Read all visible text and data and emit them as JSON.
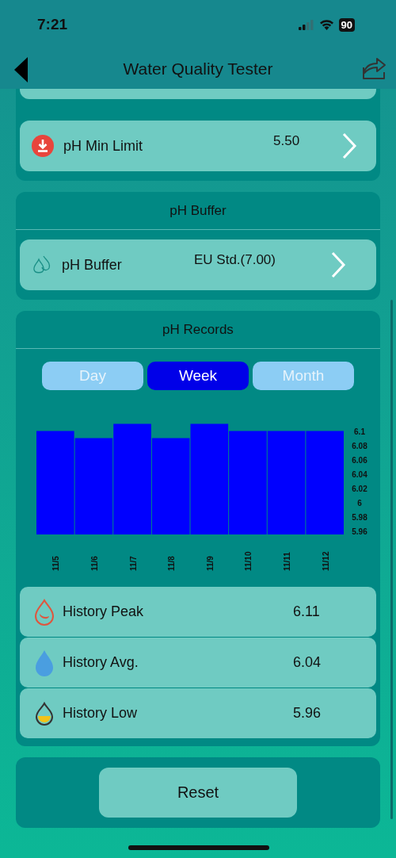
{
  "status_bar": {
    "time": "7:21",
    "battery": "90"
  },
  "nav": {
    "title": "Water Quality Tester"
  },
  "limit_row": {
    "label": "pH Min Limit",
    "value": "5.50"
  },
  "buffer": {
    "title": "pH Buffer",
    "row": {
      "label": "pH Buffer",
      "value": "EU Std.(7.00)"
    }
  },
  "records": {
    "title": "pH Records",
    "periods": [
      {
        "label": "Day",
        "selected": false
      },
      {
        "label": "Week",
        "selected": true
      },
      {
        "label": "Month",
        "selected": false
      }
    ],
    "chart_data": {
      "type": "bar",
      "categories": [
        "11/5",
        "11/6",
        "11/7",
        "11/8",
        "11/9",
        "11/10",
        "11/11",
        "11/12"
      ],
      "series": [
        {
          "color": "#0000ff",
          "values": [
            6.1,
            6.09,
            6.11,
            6.09,
            6.11,
            6.1,
            6.1,
            6.1
          ]
        }
      ],
      "ylim": [
        5.955,
        6.115
      ],
      "yticks": [
        {
          "value": 5.96,
          "label": "5.96"
        },
        {
          "value": 5.98,
          "label": "5.98"
        },
        {
          "value": 6,
          "label": "6"
        },
        {
          "value": 6.02,
          "label": "6.02"
        },
        {
          "value": 6.04,
          "label": "6.04"
        },
        {
          "value": 6.06,
          "label": "6.06"
        },
        {
          "value": 6.08,
          "label": "6.08"
        },
        {
          "value": 6.1,
          "label": "6.1"
        }
      ]
    },
    "stats": [
      {
        "kind": "peak",
        "label": "History Peak",
        "value": "6.11"
      },
      {
        "kind": "avg",
        "label": "History Avg.",
        "value": "6.04"
      },
      {
        "kind": "low",
        "label": "History Low",
        "value": "5.96"
      }
    ]
  },
  "reset": {
    "label": "Reset"
  }
}
